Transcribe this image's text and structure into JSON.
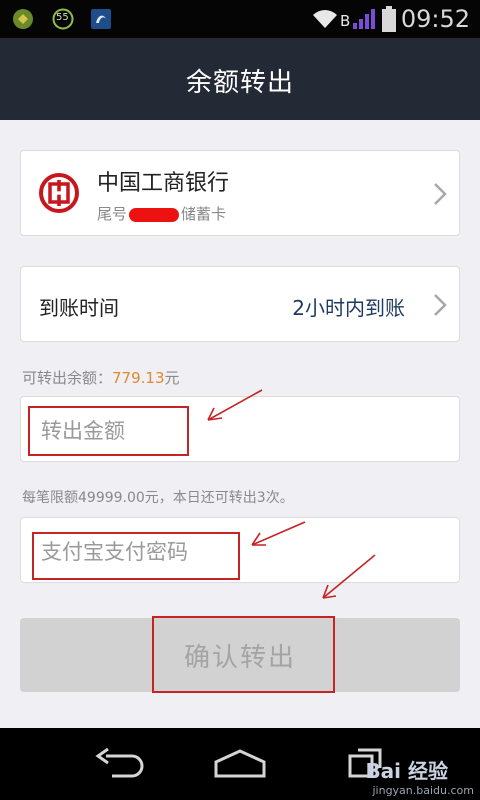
{
  "status_bar": {
    "time": "09:52",
    "battery_badge": "55",
    "signal_letter": "B"
  },
  "header": {
    "title": "余额转出"
  },
  "bank_card": {
    "bank_name": "中国工商银行",
    "tail_prefix": "尾号",
    "card_type": "储蓄卡"
  },
  "arrival": {
    "label": "到账时间",
    "value": "2小时内到账"
  },
  "balance": {
    "label": "可转出余额：",
    "amount": "779.13",
    "unit": "元"
  },
  "amount_field": {
    "placeholder": "转出金额",
    "value": ""
  },
  "limit_note": "每笔限额49999.00元，本日还可转出3次。",
  "password_field": {
    "placeholder": "支付宝支付密码",
    "value": ""
  },
  "confirm_button": {
    "label": "确认转出"
  },
  "watermark": {
    "logo": "Bai 经验",
    "url": "jingyan.baidu.com"
  },
  "colors": {
    "header_bg": "#232935",
    "balance_amount": "#e08a2e",
    "arrival_value": "#1f3a5f",
    "annotation_red": "#c42424",
    "button_disabled_bg": "#d2d2d2"
  },
  "icons": [
    "status-app-icon-1",
    "status-app-icon-2",
    "status-app-icon-3",
    "wifi-icon",
    "signal-icon",
    "battery-icon",
    "icbc-logo-icon",
    "chevron-right-icon",
    "back-icon",
    "home-icon",
    "recent-apps-icon"
  ]
}
